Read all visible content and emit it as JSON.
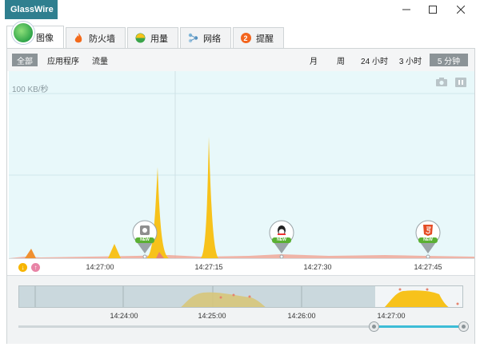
{
  "app": {
    "title": "GlassWire"
  },
  "tabs": [
    {
      "id": "graph",
      "label": "图像",
      "icon": "globe-icon",
      "active": true
    },
    {
      "id": "firewall",
      "label": "防火墙",
      "icon": "flame-icon",
      "active": false
    },
    {
      "id": "usage",
      "label": "用量",
      "icon": "usage-icon",
      "active": false
    },
    {
      "id": "network",
      "label": "网络",
      "icon": "network-icon",
      "active": false
    },
    {
      "id": "alerts",
      "label": "提醒",
      "icon": "alert-icon",
      "badge": "2",
      "active": false
    }
  ],
  "filters": [
    {
      "label": "全部",
      "active": true
    },
    {
      "label": "应用程序",
      "active": false
    },
    {
      "label": "流量",
      "active": false
    }
  ],
  "ranges": [
    {
      "label": "月",
      "active": false
    },
    {
      "label": "周",
      "active": false
    },
    {
      "label": "24 小时",
      "active": false
    },
    {
      "label": "3 小时",
      "active": false
    },
    {
      "label": "5 分钟",
      "active": true
    }
  ],
  "graph": {
    "scale_label": "100 KB/秒",
    "time_ticks": [
      "14:27:00",
      "14:27:15",
      "14:27:30",
      "14:27:45"
    ],
    "badges": [
      "NEW",
      "NEW",
      "NEW"
    ]
  },
  "legend": {
    "incoming": "↓",
    "outgoing": "↑"
  },
  "overview": {
    "time_ticks": [
      "14:24:00",
      "14:25:00",
      "14:26:00",
      "14:27:00"
    ]
  },
  "colors": {
    "brand": "#2f7f8f",
    "incoming": "#f7c21b",
    "outgoing": "#e6846f",
    "graph_bg": "#e8f8fa",
    "badge_green": "#5ab033"
  }
}
